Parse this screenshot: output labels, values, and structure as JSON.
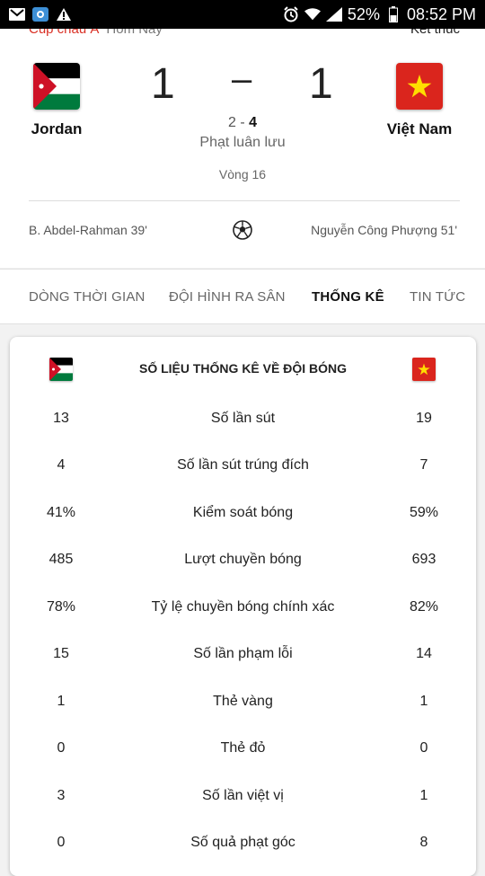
{
  "status_bar": {
    "battery": "52%",
    "time": "08:52 PM",
    "icons": [
      "gmail-icon",
      "app-icon",
      "warning-icon",
      "alarm-icon",
      "wifi-icon",
      "signal-icon",
      "battery-icon"
    ]
  },
  "match": {
    "competition": "Cúp châu Á",
    "day": "Hôm Nay",
    "status": "Kết thúc",
    "home": {
      "name": "Jordan",
      "score": "1",
      "scorer": "B. Abdel-Rahman 39'"
    },
    "away": {
      "name": "Việt Nam",
      "score": "1",
      "scorer": "Nguyễn Công Phượng 51'"
    },
    "dash": "–",
    "pens_home": "2",
    "pens_sep": " - ",
    "pens_away": "4",
    "pens_label": "Phạt luân lưu",
    "round": "Vòng 16"
  },
  "tabs": [
    {
      "label": "DÒNG THỜI GIAN",
      "active": false
    },
    {
      "label": "ĐỘI HÌNH RA SÂN",
      "active": false
    },
    {
      "label": "THỐNG KÊ",
      "active": true
    },
    {
      "label": "TIN TỨC",
      "active": false
    }
  ],
  "stats": {
    "title": "SỐ LIỆU THỐNG KÊ VỀ ĐỘI BÓNG",
    "rows": [
      {
        "home": "13",
        "label": "Số lần sút",
        "away": "19"
      },
      {
        "home": "4",
        "label": "Số lần sút trúng đích",
        "away": "7"
      },
      {
        "home": "41%",
        "label": "Kiểm soát bóng",
        "away": "59%"
      },
      {
        "home": "485",
        "label": "Lượt chuyền bóng",
        "away": "693"
      },
      {
        "home": "78%",
        "label": "Tỷ lệ chuyền bóng chính xác",
        "away": "82%"
      },
      {
        "home": "15",
        "label": "Số lần phạm lỗi",
        "away": "14"
      },
      {
        "home": "1",
        "label": "Thẻ vàng",
        "away": "1"
      },
      {
        "home": "0",
        "label": "Thẻ đỏ",
        "away": "0"
      },
      {
        "home": "3",
        "label": "Số lần việt vị",
        "away": "1"
      },
      {
        "home": "0",
        "label": "Số quả phạt góc",
        "away": "8"
      }
    ]
  },
  "colors": {
    "jordan_red": "#ce1126",
    "jordan_green": "#007a3d",
    "vietnam_red": "#da251d",
    "vietnam_star": "#ffde00",
    "competition_red": "#d93025"
  }
}
